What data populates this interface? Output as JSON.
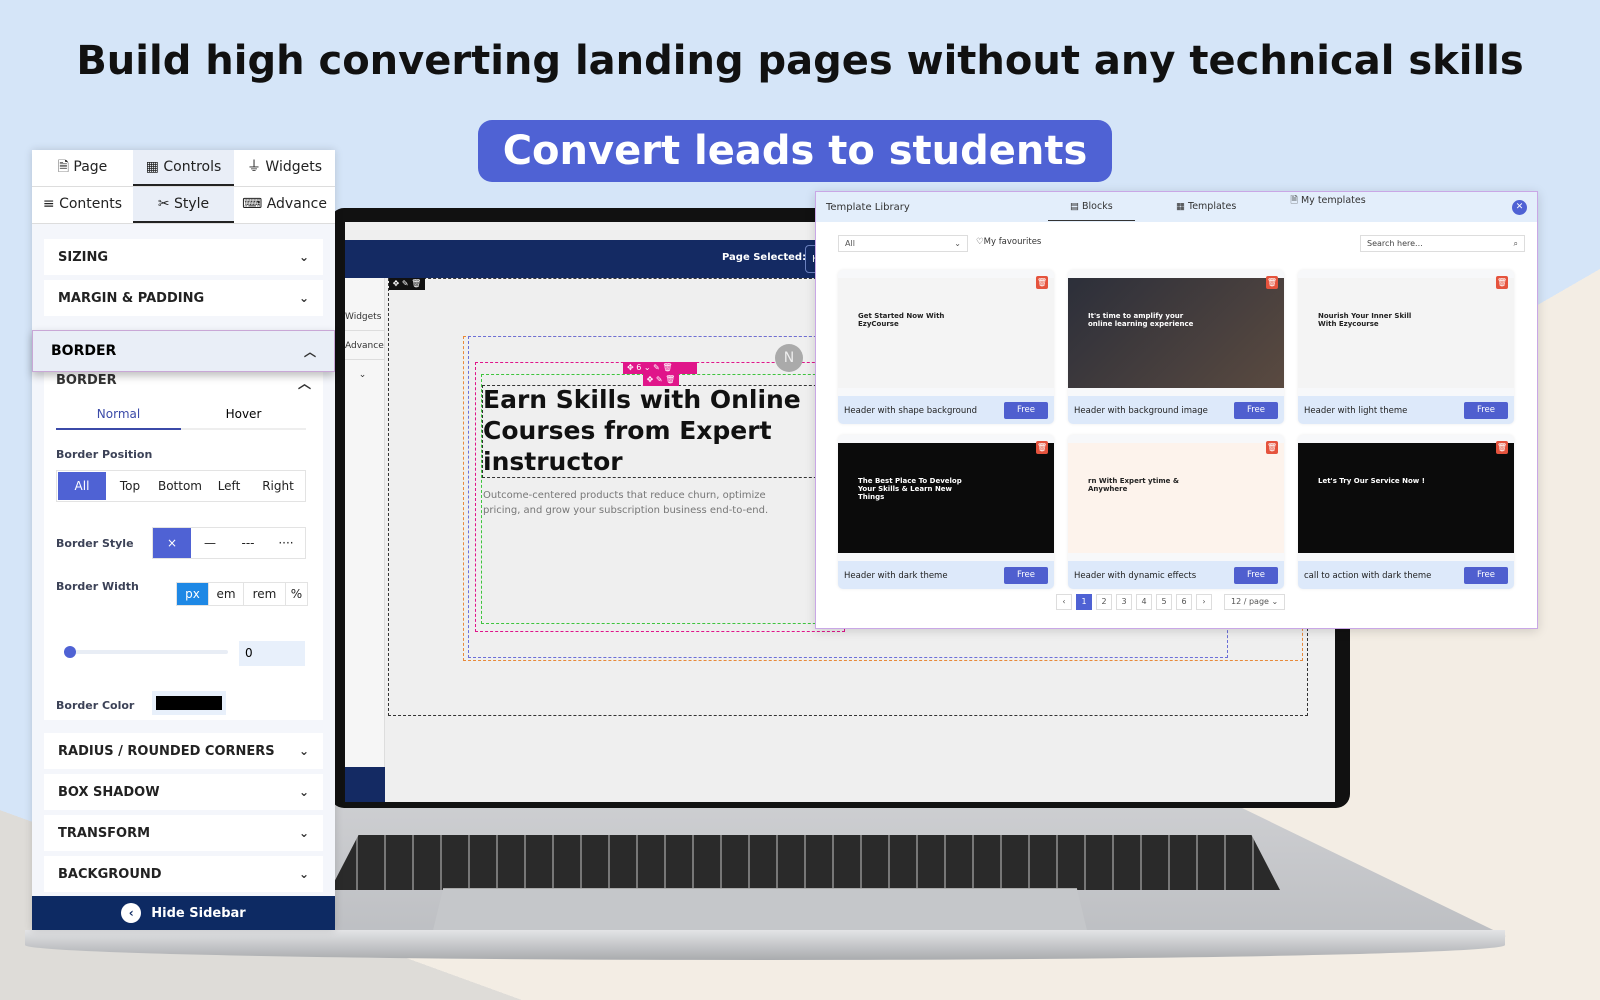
{
  "headline": "Build high converting landing pages without any technical skills",
  "subheadline": "Convert leads to students",
  "colors": {
    "accent": "#4f62d4",
    "navy": "#142a63",
    "magenta": "#e0158a",
    "delete": "#e5533d"
  },
  "sidebar": {
    "tabs_top": [
      {
        "label": "Page",
        "icon": "file-icon"
      },
      {
        "label": "Controls",
        "icon": "layout-icon",
        "active": true
      },
      {
        "label": "Widgets",
        "icon": "plug-icon"
      }
    ],
    "tabs_bottom": [
      {
        "label": "Contents",
        "icon": "menu-icon"
      },
      {
        "label": "Style",
        "icon": "tools-icon",
        "active": true
      },
      {
        "label": "Advance",
        "icon": "code-icon"
      }
    ],
    "sections_top": [
      "SIZING",
      "MARGIN & PADDING"
    ],
    "border_header": "BORDER",
    "border_ghost": "BORDER",
    "state_tabs": [
      "Normal",
      "Hover"
    ],
    "border_position_label": "Border Position",
    "border_positions": [
      "All",
      "Top",
      "Bottom",
      "Left",
      "Right"
    ],
    "border_style_label": "Border Style",
    "border_styles": [
      "×",
      "—",
      "---",
      "····"
    ],
    "border_width_label": "Border Width",
    "units": [
      "px",
      "em",
      "rem",
      "%"
    ],
    "border_width_value": "0",
    "border_color_label": "Border Color",
    "border_color": "#000000",
    "sections_bottom": [
      "RADIUS / ROUNDED CORNERS",
      "BOX SHADOW",
      "TRANSFORM",
      "BACKGROUND"
    ],
    "hide_sidebar": "Hide Sidebar"
  },
  "editor": {
    "page_selected_label": "Page Selected:",
    "page_selected_value": "Home",
    "left_tabs": [
      "Widgets",
      "Advance"
    ],
    "hero_title": "Earn Skills with Online Courses from Expert instructor",
    "hero_subtitle": "Outcome-centered products that reduce churn, optimize pricing, and grow your subscription business end-to-end.",
    "avatar_letter": "N",
    "toolbar_value": "6"
  },
  "library": {
    "title": "Template Library",
    "tabs": [
      "Blocks",
      "Templates",
      "My templates"
    ],
    "filter": "All",
    "favourites": "My favourites",
    "search_placeholder": "Search here...",
    "free_label": "Free",
    "cards": [
      {
        "name": "Header with shape background",
        "thumb_text": "Get Started Now With EzyCourse",
        "theme": "light"
      },
      {
        "name": "Header with background image",
        "thumb_text": "It's time to amplify your online learning experience",
        "theme": "photo"
      },
      {
        "name": "Header with light theme",
        "thumb_text": "Nourish Your Inner Skill With Ezycourse",
        "theme": "light"
      },
      {
        "name": "Header with dark theme",
        "thumb_text": "The Best Place To Develop Your Skills & Learn New Things",
        "theme": "dark"
      },
      {
        "name": "Header with dynamic effects",
        "thumb_text": "rn With Expert ytime & Anywhere",
        "theme": "cream"
      },
      {
        "name": "call to action with dark theme",
        "thumb_text": "Let's Try Our Service Now !",
        "theme": "dark"
      }
    ],
    "pages": [
      "1",
      "2",
      "3",
      "4",
      "5",
      "6"
    ],
    "current_page": "1",
    "page_size": "12 / page"
  }
}
